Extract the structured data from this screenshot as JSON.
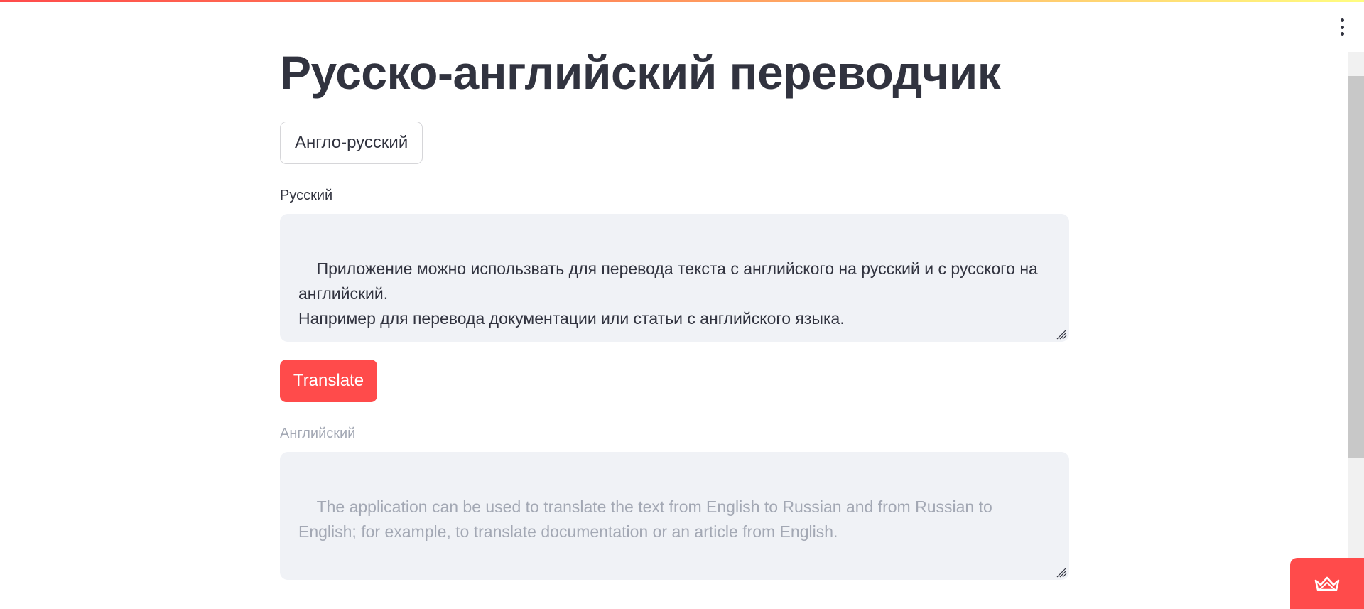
{
  "app": {
    "title": "Русско-английский переводчик",
    "accent_color": "#ff4b4b"
  },
  "mode_button": {
    "label": "Англо-русский"
  },
  "source_field": {
    "label": "Русский",
    "value": "Приложение можно использвать для перевода текста с английского на русский и с русского на английский.\nНапример для перевода документации или статьи с английского языка."
  },
  "translate_button": {
    "label": "Translate"
  },
  "target_field": {
    "label": "Английский",
    "value": "The application can be used to translate the text from English to Russian and from Russian to English; for example, to translate documentation or an article from English.",
    "disabled": true
  },
  "icons": {
    "menu": "kebab-menu-icon",
    "badge": "streamlit-crown-icon"
  }
}
